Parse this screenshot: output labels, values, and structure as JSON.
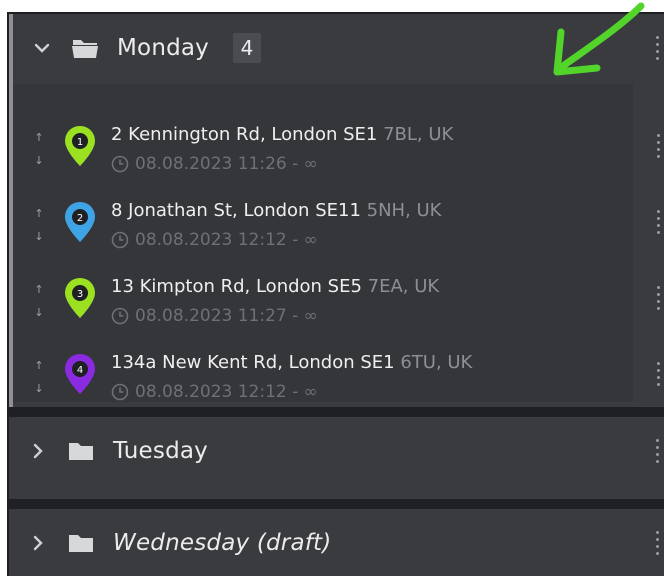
{
  "groups": [
    {
      "name": "Monday",
      "count": "4",
      "expanded": true,
      "chevron_icon": "chevron-down-icon",
      "folder_icon": "folder-open-icon",
      "stops": [
        {
          "number": "1",
          "pin_color": "#9be021",
          "address_main": "2 Kennington Rd, London SE1",
          "address_rest": " 7BL, UK",
          "time": "08.08.2023 11:26 - ∞"
        },
        {
          "number": "2",
          "pin_color": "#3fa4e6",
          "address_main": "8 Jonathan St, London SE11",
          "address_rest": " 5NH, UK",
          "time": "08.08.2023 12:12 - ∞"
        },
        {
          "number": "3",
          "pin_color": "#9be021",
          "address_main": "13 Kimpton Rd, London SE5",
          "address_rest": " 7EA, UK",
          "time": "08.08.2023 11:27 - ∞"
        },
        {
          "number": "4",
          "pin_color": "#8a2be2",
          "address_main": "134a New Kent Rd, London SE1",
          "address_rest": " 6TU, UK",
          "time": "08.08.2023 12:12 - ∞"
        }
      ]
    },
    {
      "name": "Tuesday",
      "expanded": false,
      "chevron_icon": "chevron-right-icon",
      "folder_icon": "folder-icon"
    },
    {
      "name": "Wednesday (draft)",
      "expanded": false,
      "chevron_icon": "chevron-right-icon",
      "folder_icon": "folder-icon"
    }
  ],
  "colors": {
    "arrow_annotation": "#53d42a",
    "panel": "#3a3b3f",
    "background": "#1f2023"
  },
  "icons": [
    "chevron-down-icon",
    "chevron-right-icon",
    "folder-open-icon",
    "folder-icon",
    "map-pin-icon",
    "clock-icon",
    "reorder-arrows-icon",
    "more-vertical-icon",
    "annotation-arrow-icon"
  ]
}
